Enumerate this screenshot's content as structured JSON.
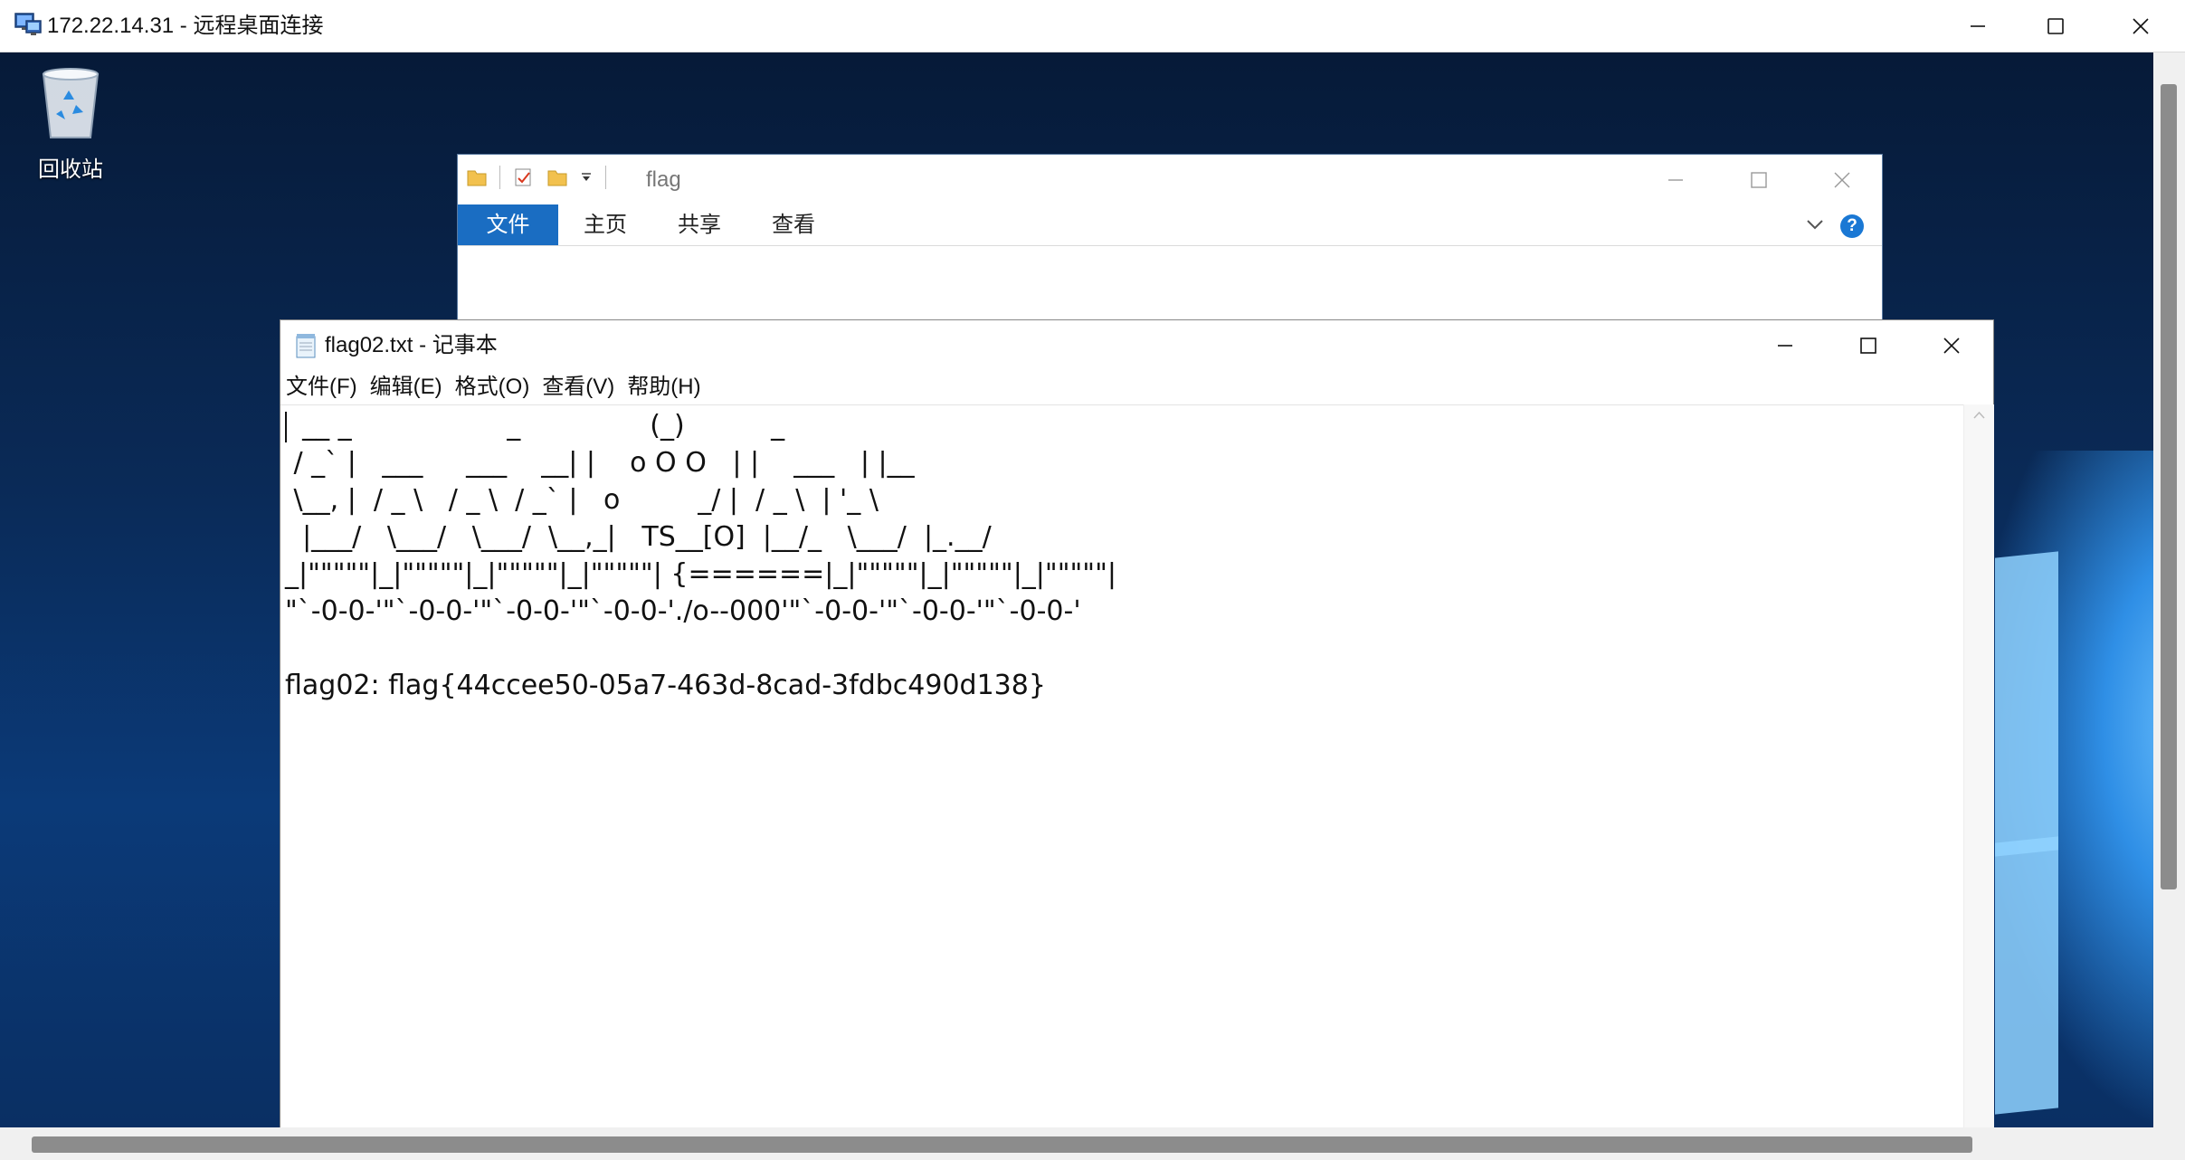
{
  "rdp": {
    "title": "172.22.14.31 - 远程桌面连接"
  },
  "desktop": {
    "recycle_bin_label": "回收站"
  },
  "explorer": {
    "title": "flag",
    "tabs": [
      {
        "label": "文件",
        "active": true
      },
      {
        "label": "主页",
        "active": false
      },
      {
        "label": "共享",
        "active": false
      },
      {
        "label": "查看",
        "active": false
      }
    ],
    "help_label": "?"
  },
  "notepad": {
    "title": "flag02.txt - 记事本",
    "menu": [
      "文件(F)",
      "编辑(E)",
      "格式(O)",
      "查看(V)",
      "帮助(H)"
    ],
    "content": "  __ _                  _               (_)          _\n / _` |   ___     ___    __| |    o O O   | |    ___   | |__\n \\__, |  / _ \\   / _ \\  / _` |   o         _/ |  / _ \\  | '_ \\\n  |___/   \\___/   \\___/  \\__,_|   TS__[O]  |__/_   \\___/  |_.__/\n_|\"\"\"\"\"|_|\"\"\"\"\"|_|\"\"\"\"\"|_|\"\"\"\"\"| {======|_|\"\"\"\"\"|_|\"\"\"\"\"|_|\"\"\"\"\"|\n\"`-0-0-'\"`-0-0-'\"`-0-0-'\"`-0-0-'./o--000'\"`-0-0-'\"`-0-0-'\"`-0-0-'\n\nflag02: flag{44ccee50-05a7-463d-8cad-3fdbc490d138}"
  },
  "colors": {
    "ribbon_active": "#1a6dc2",
    "desktop_bg": "#0a2a57",
    "help_blue": "#1a78d4"
  }
}
